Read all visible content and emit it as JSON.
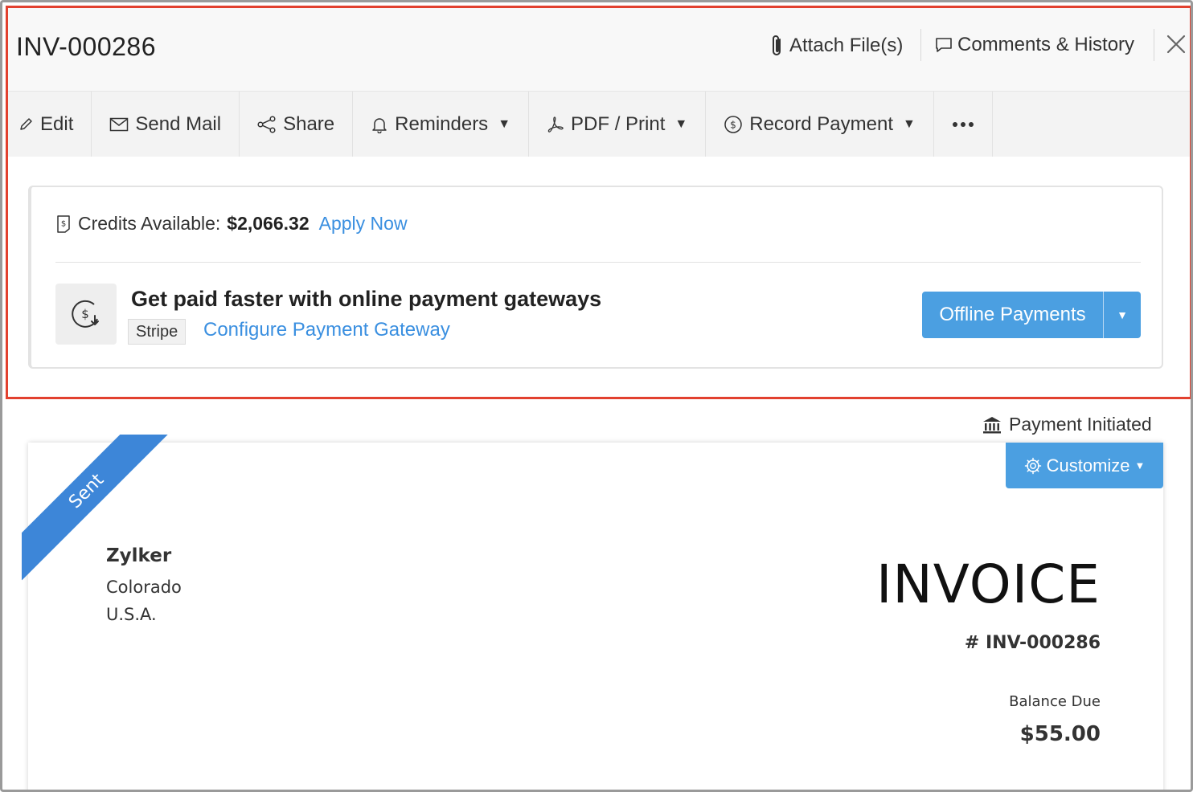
{
  "header": {
    "title": "INV-000286",
    "attach_label": "Attach File(s)",
    "comments_label": "Comments & History"
  },
  "toolbar": {
    "items": [
      {
        "label": "Edit",
        "icon": "pencil-icon",
        "dropdown": false
      },
      {
        "label": "Send Mail",
        "icon": "mail-icon",
        "dropdown": false
      },
      {
        "label": "Share",
        "icon": "share-icon",
        "dropdown": false
      },
      {
        "label": "Reminders",
        "icon": "bell-icon",
        "dropdown": true
      },
      {
        "label": "PDF / Print",
        "icon": "pdf-icon",
        "dropdown": true
      },
      {
        "label": "Record Payment",
        "icon": "dollar-circle-icon",
        "dropdown": true
      }
    ],
    "more_icon": "more-icon"
  },
  "credits": {
    "label": "Credits Available:",
    "amount": "$2,066.32",
    "apply_label": "Apply Now"
  },
  "gateway": {
    "title": "Get paid faster with online payment gateways",
    "tag": "Stripe",
    "configure_label": "Configure Payment Gateway",
    "offline_label": "Offline Payments"
  },
  "status": {
    "payment_label": "Payment Initiated",
    "customize_label": "Customize",
    "ribbon_label": "Sent"
  },
  "invoice": {
    "org_name": "Zylker",
    "org_state": "Colorado",
    "org_country": "U.S.A.",
    "heading": "INVOICE",
    "number": "# INV-000286",
    "balance_label": "Balance Due",
    "balance_amount": "$55.00"
  },
  "colors": {
    "accent": "#4b9fe1",
    "link": "#3a8fe0",
    "ribbon": "#3d86d8",
    "highlight": "#e2412f"
  }
}
